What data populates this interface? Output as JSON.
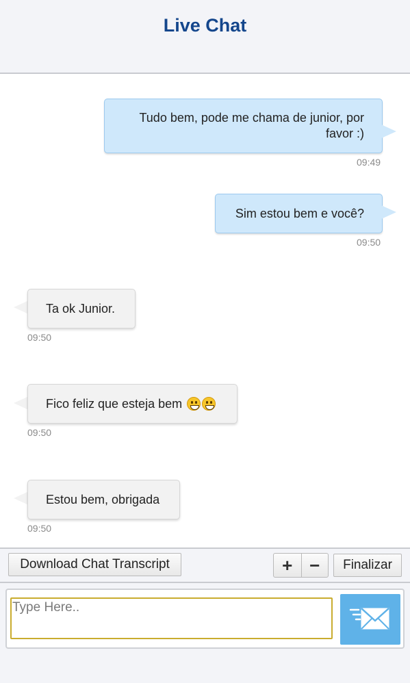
{
  "header": {
    "title": "Live Chat"
  },
  "messages": [
    {
      "direction": "outgoing",
      "text_line1": "Tudo bem, pode me chama de junior, por",
      "text_line2": "favor :)",
      "time": "09:49"
    },
    {
      "direction": "outgoing",
      "text": "Sim estou bem e você?",
      "time": "09:50"
    },
    {
      "direction": "incoming",
      "text": "Ta ok Junior.",
      "time": "09:50"
    },
    {
      "direction": "incoming",
      "text": "Fico feliz que esteja bem",
      "emojis": [
        "grinning-face-icon",
        "grinning-face-icon"
      ],
      "time": "09:50"
    },
    {
      "direction": "incoming",
      "text": "Estou bem, obrigada",
      "time": "09:50"
    }
  ],
  "toolbar": {
    "download_label": "Download Chat Transcript",
    "zoom_in_label": "+",
    "zoom_out_label": "−",
    "end_label": "Finalizar"
  },
  "composer": {
    "placeholder": "Type Here..",
    "value": "",
    "send_icon": "envelope-send-icon"
  },
  "colors": {
    "title": "#14468c",
    "outgoing_bubble": "#cfe8fb",
    "incoming_bubble": "#f2f2f2",
    "send_button": "#5fb2e8",
    "input_border": "#c9ac2e"
  }
}
